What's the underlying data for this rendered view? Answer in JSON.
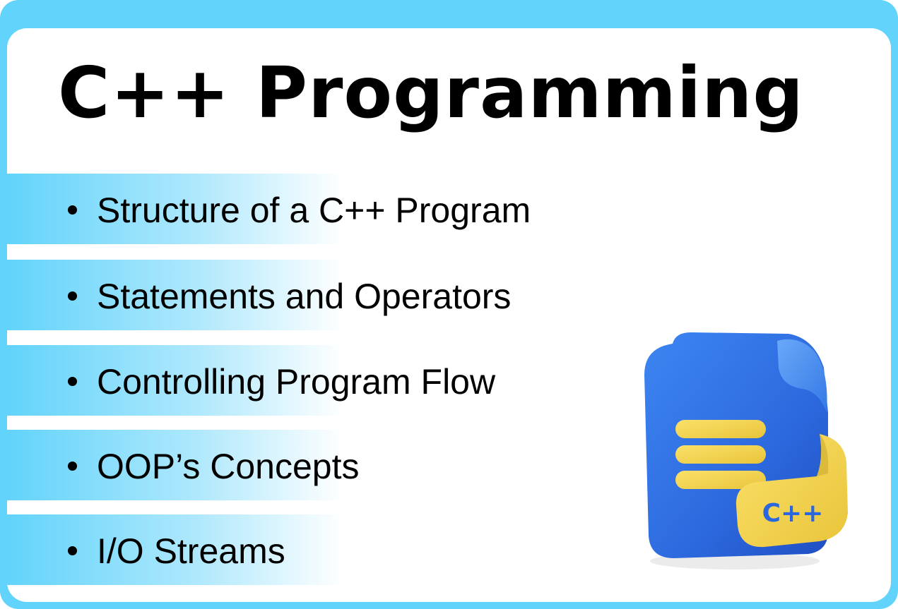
{
  "title": "C++ Programming",
  "topics": [
    "Structure of a C++ Program",
    "Statements and Operators",
    "Controlling Program Flow",
    "OOP’s Concepts",
    "I/O Streams"
  ],
  "illustration": {
    "icon": "cpp-file-icon",
    "badge_text": "C++",
    "colors": {
      "frame": "#62d3fb",
      "file": "#2f6fe0",
      "ribbon": "#f5d64a",
      "badge_text": "#2a67de"
    }
  }
}
